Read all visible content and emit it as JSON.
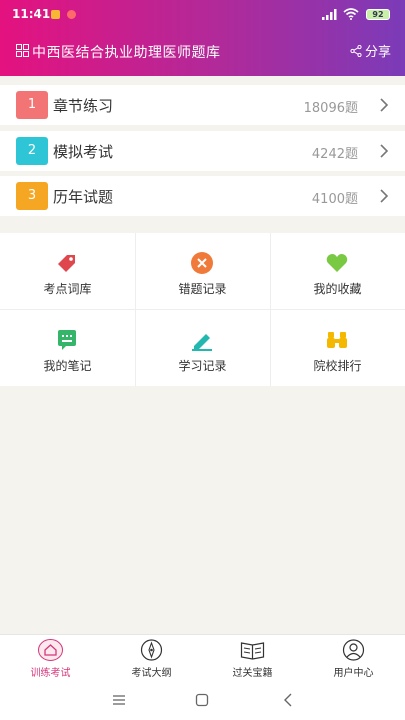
{
  "status": {
    "time": "11:41",
    "battery": "92"
  },
  "header": {
    "title": "中西医结合执业助理医师题库",
    "share_label": "分享"
  },
  "categories": [
    {
      "index": "1",
      "name": "章节练习",
      "count": "18096题",
      "color": "#f27474"
    },
    {
      "index": "2",
      "name": "模拟考试",
      "count": "4242题",
      "color": "#2ec6d6"
    },
    {
      "index": "3",
      "name": "历年试题",
      "count": "4100题",
      "color": "#f5a623"
    }
  ],
  "tiles": [
    {
      "label": "考点词库",
      "icon": "tag-icon"
    },
    {
      "label": "错题记录",
      "icon": "close-circle-icon"
    },
    {
      "label": "我的收藏",
      "icon": "heart-icon"
    },
    {
      "label": "我的笔记",
      "icon": "note-icon"
    },
    {
      "label": "学习记录",
      "icon": "pen-icon"
    },
    {
      "label": "院校排行",
      "icon": "binoculars-icon"
    }
  ],
  "tabs": [
    {
      "label": "训练考试",
      "icon": "home-icon",
      "active": true
    },
    {
      "label": "考试大纲",
      "icon": "compass-icon",
      "active": false
    },
    {
      "label": "过关宝籍",
      "icon": "book-icon",
      "active": false
    },
    {
      "label": "用户中心",
      "icon": "user-icon",
      "active": false
    }
  ],
  "colors": {
    "accent": "#d6357a",
    "header_start": "#e4127f",
    "header_end": "#7b3bb8"
  }
}
